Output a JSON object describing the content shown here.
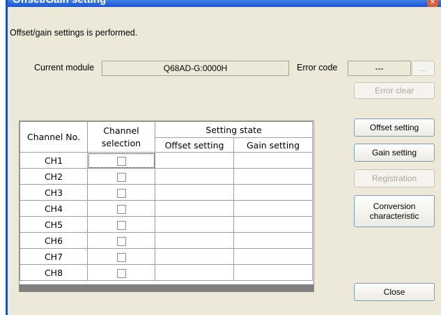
{
  "window": {
    "title": "Offset/Gain setting",
    "close_glyph": "✕"
  },
  "description": "Offset/gain settings is performed.",
  "module": {
    "label": "Current module",
    "value": "Q68AD-G:0000H"
  },
  "error": {
    "label": "Error code",
    "value": "---",
    "browse_label": "...",
    "clear_label": "Error clear"
  },
  "table": {
    "headers": {
      "channel_no": "Channel No.",
      "channel_selection": "Channel\nselection",
      "setting_state": "Setting state",
      "offset": "Offset setting",
      "gain": "Gain setting"
    },
    "rows": [
      {
        "ch": "CH1",
        "offset": "",
        "gain": ""
      },
      {
        "ch": "CH2",
        "offset": "",
        "gain": ""
      },
      {
        "ch": "CH3",
        "offset": "",
        "gain": ""
      },
      {
        "ch": "CH4",
        "offset": "",
        "gain": ""
      },
      {
        "ch": "CH5",
        "offset": "",
        "gain": ""
      },
      {
        "ch": "CH6",
        "offset": "",
        "gain": ""
      },
      {
        "ch": "CH7",
        "offset": "",
        "gain": ""
      },
      {
        "ch": "CH8",
        "offset": "",
        "gain": ""
      }
    ]
  },
  "buttons": {
    "offset": "Offset setting",
    "gain": "Gain setting",
    "registration": "Registration",
    "conversion": "Conversion\ncharacteristic",
    "close": "Close"
  }
}
